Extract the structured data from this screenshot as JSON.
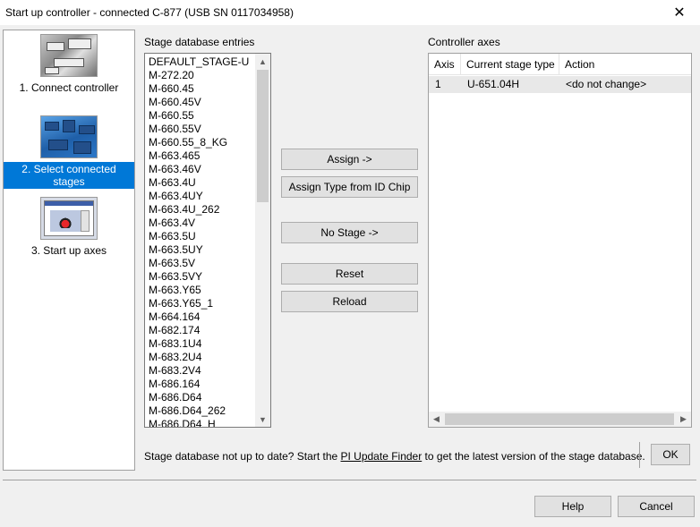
{
  "window": {
    "title": "Start up controller - connected C-877 (USB SN 0117034958)",
    "close_glyph": "✕"
  },
  "sidebar": {
    "steps": [
      {
        "label": "1. Connect controller",
        "icon": "controller-photo-icon"
      },
      {
        "label": "2. Select connected stages",
        "icon": "stages-photo-icon",
        "selected": true
      },
      {
        "label": "3. Start up axes",
        "icon": "axes-plot-icon"
      }
    ]
  },
  "stage_db": {
    "label": "Stage database entries",
    "items": [
      "DEFAULT_STAGE-U",
      "M-272.20",
      "M-660.45",
      "M-660.45V",
      "M-660.55",
      "M-660.55V",
      "M-660.55_8_KG",
      "M-663.465",
      "M-663.46V",
      "M-663.4U",
      "M-663.4UY",
      "M-663.4U_262",
      "M-663.4V",
      "M-663.5U",
      "M-663.5UY",
      "M-663.5V",
      "M-663.5VY",
      "M-663.Y65",
      "M-663.Y65_1",
      "M-664.164",
      "M-682.174",
      "M-683.1U4",
      "M-683.2U4",
      "M-683.2V4",
      "M-686.164",
      "M-686.D64",
      "M-686.D64_262",
      "M-686.D64_H"
    ]
  },
  "buttons": {
    "assign": "Assign ->",
    "assign_type": "Assign Type from ID Chip",
    "no_stage": "No Stage ->",
    "reset": "Reset",
    "reload": "Reload"
  },
  "controller_axes": {
    "label": "Controller axes",
    "columns": [
      "Axis",
      "Current stage type",
      "Action"
    ],
    "rows": [
      {
        "axis": "1",
        "stage_type": "U-651.04H",
        "action": "<do not change>"
      }
    ]
  },
  "info": {
    "before": "Stage database not up to date? Start the ",
    "link": "PI Update Finder",
    "after": " to get the latest version of the stage database."
  },
  "footer": {
    "ok": "OK",
    "help": "Help",
    "cancel": "Cancel"
  },
  "colors": {
    "selection": "#0078d7",
    "button_face": "#e1e1e1",
    "window_bg": "#f0f0f0"
  }
}
